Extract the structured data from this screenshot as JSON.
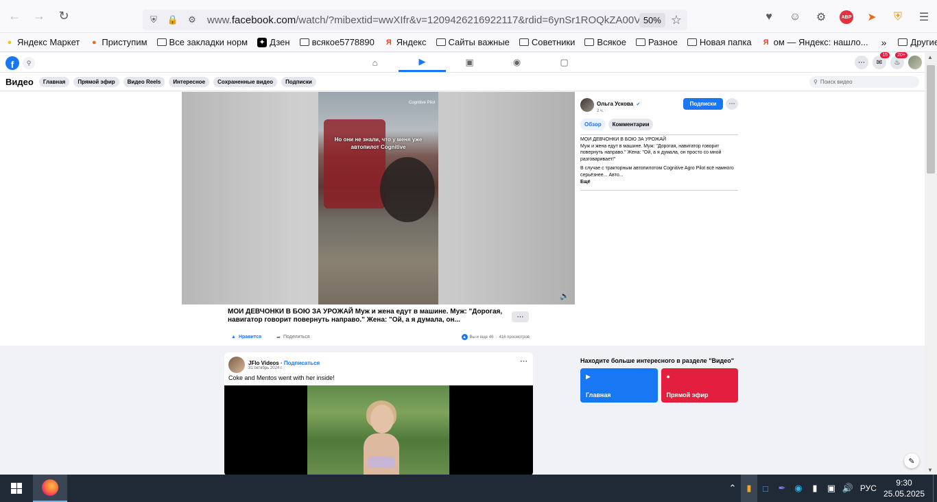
{
  "browser": {
    "url_prefix": "www.",
    "url_domain": "facebook.com",
    "url_rest": "/watch/?mibextid=wwXIfr&v=1209426216922117&rdid=6ynSr1ROQkZA00VD",
    "zoom": "50%",
    "icons": {
      "back": "back-arrow-icon",
      "forward": "forward-arrow-icon",
      "reload": "reload-icon",
      "shield": "shield-icon",
      "lock": "lock-icon",
      "permissions": "permissions-icon",
      "bookmark_star": "star-icon",
      "pocket": "pocket-icon",
      "account": "account-icon",
      "extensions": "extensions-icon",
      "menu": "hamburger-menu-icon"
    },
    "abp_label": "ABP"
  },
  "bookmarks": [
    {
      "label": "Яндекс Маркет",
      "icon": "yandex-market-icon"
    },
    {
      "label": "Приступим",
      "icon": "firefox-icon"
    },
    {
      "label": "Все закладки норм",
      "icon": "folder-icon"
    },
    {
      "label": "Дзен",
      "icon": "dzen-icon"
    },
    {
      "label": "всякое5778890",
      "icon": "folder-icon"
    },
    {
      "label": "Яндекс",
      "icon": "yandex-icon"
    },
    {
      "label": "Сайты важные",
      "icon": "folder-icon"
    },
    {
      "label": "Советники",
      "icon": "folder-icon"
    },
    {
      "label": "Всякое",
      "icon": "folder-icon"
    },
    {
      "label": "Разное",
      "icon": "folder-icon"
    },
    {
      "label": "Новая папка",
      "icon": "folder-icon"
    },
    {
      "label": "ом — Яндекс: нашло...",
      "icon": "yandex-icon"
    }
  ],
  "bookmarks_other": "Другие закладки",
  "fb": {
    "badges": {
      "messenger": "15",
      "notifications": "20+"
    },
    "video_title": "Видео",
    "subnav": [
      "Главная",
      "Прямой эфир",
      "Видео Reels",
      "Интересное",
      "Сохраненные видео",
      "Подписки"
    ],
    "search_placeholder": "Поиск видео"
  },
  "video": {
    "caption": "Но они не знали, что у меня уже автопилот Cognitive",
    "watermark": "Cognitive Pilot",
    "desc": "МОИ ДЕВЧОНКИ В БОЮ ЗА УРОЖАЙ Муж и жена едут в машине. Муж: \"Дорогая, навигатор говорит повернуть направо.\" Жена: \"Ой, а я думала, он...",
    "like_label": "Нравится",
    "share_label": "Поделиться",
    "reactions": "Вы и еще 46",
    "views": "416 просмотров"
  },
  "panel": {
    "author": "Ольга Ускова",
    "time": "2 ч. ·",
    "subscribe": "Подписки",
    "tabs": [
      "Обзор",
      "Комментарии"
    ],
    "text1": "МОИ ДЕВЧОНКИ В БОЮ ЗА УРОЖАЙ",
    "text2": "Муж и жена едут в машине. Муж: \"Дорогая, навигатор говорит повернуть направо.\" Жена: \"Ой, а я думала, он просто со мной разговаривает!\"",
    "text3": "В случае с тракторным автопилотом Cognitive Agro Pilot всё намного серьёзнее... Авто...",
    "more": "Ещё"
  },
  "card": {
    "author": "JFlo Videos",
    "follow": "Подписаться",
    "date": "31 октябрь 2024 г. ·",
    "text": "Coke and Mentos went with her inside!"
  },
  "discover": {
    "title": "Находите больше интересного в разделе \"Видео\"",
    "home": "Главная",
    "live": "Прямой эфир"
  },
  "taskbar": {
    "lang": "РУС",
    "time": "9:30",
    "date": "25.05.2025"
  }
}
